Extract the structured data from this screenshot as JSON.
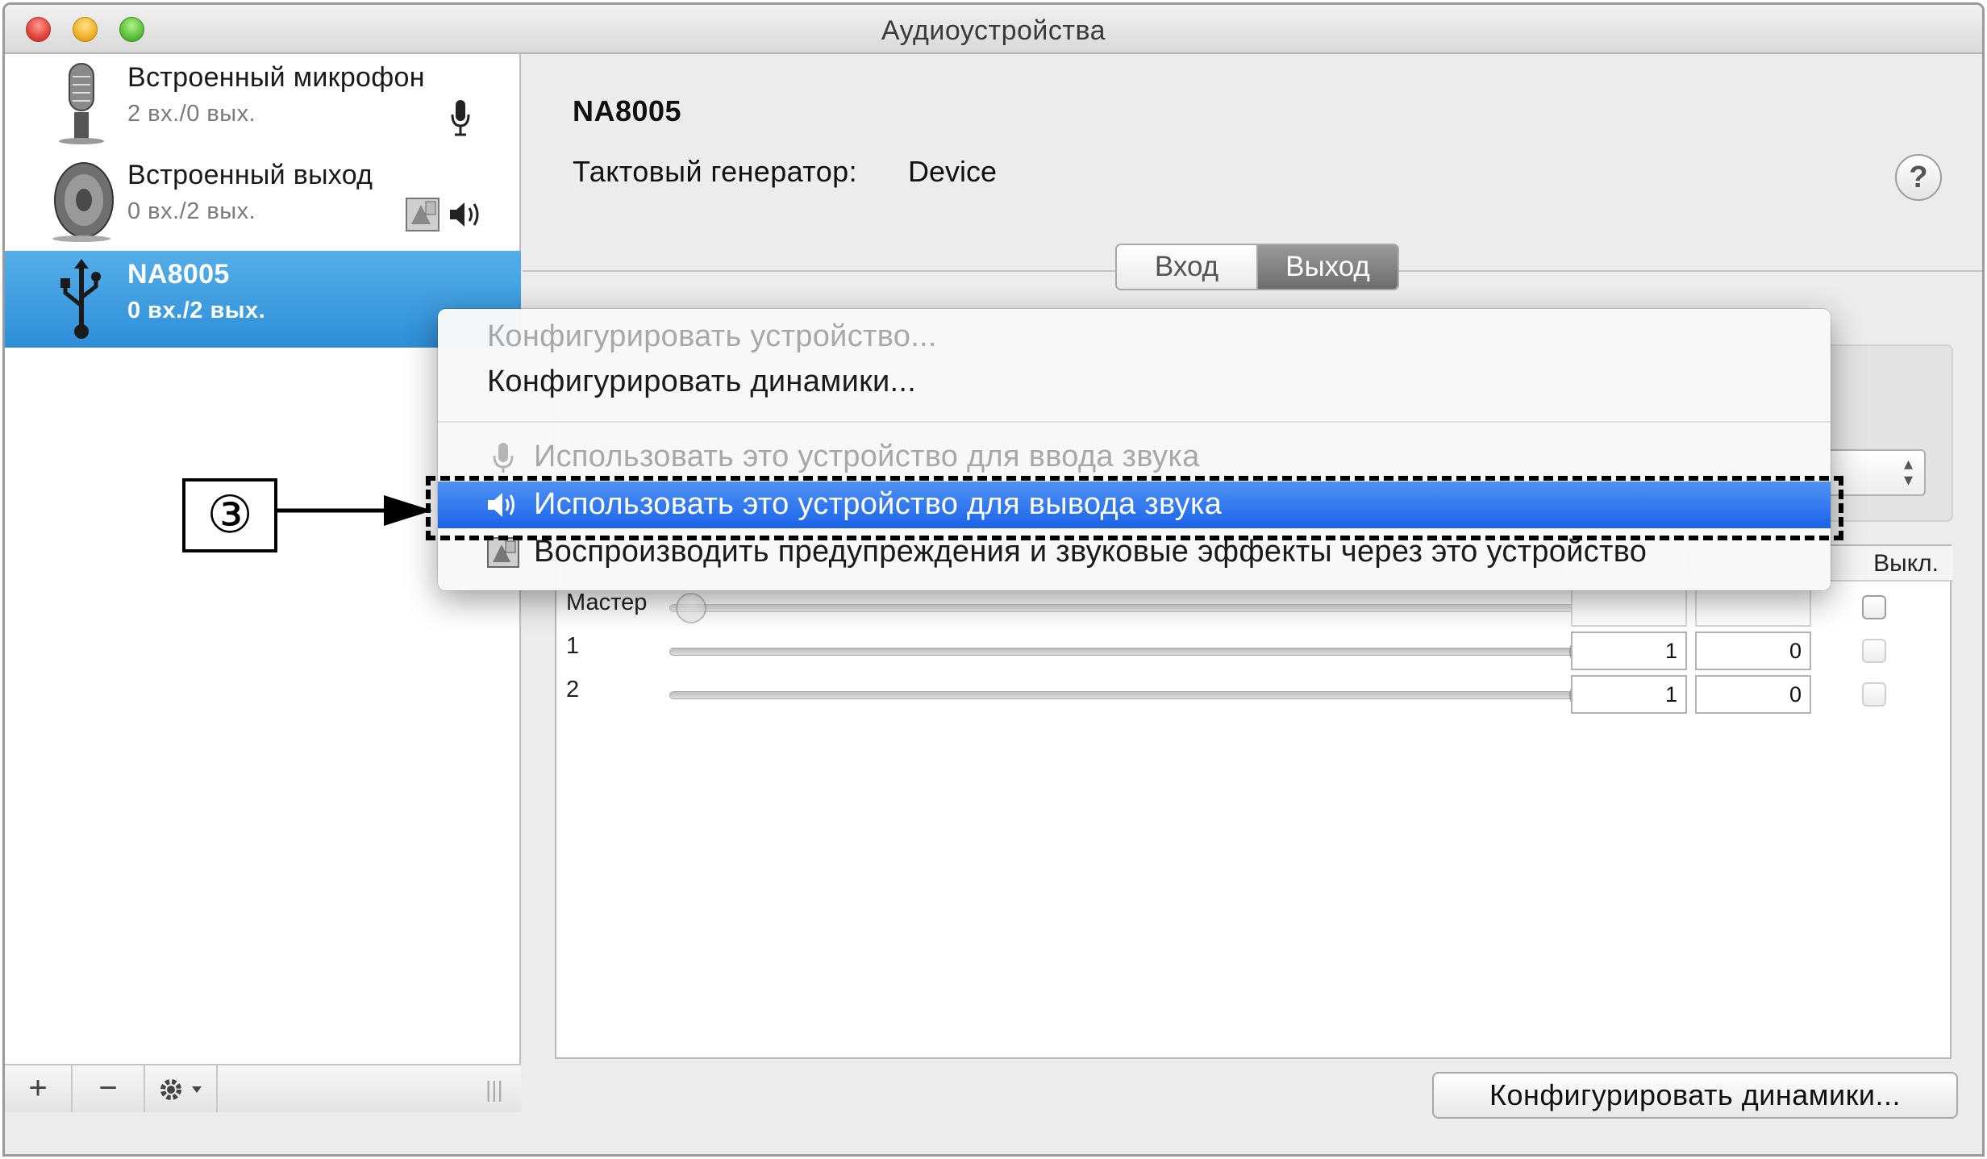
{
  "window": {
    "title": "Аудиоустройства"
  },
  "sidebar": {
    "devices": [
      {
        "name": "Встроенный микрофон",
        "channels": "2 вх./0 вых.",
        "icon": "microphone-icon",
        "badges": [
          "mic-badge-icon"
        ]
      },
      {
        "name": "Встроенный выход",
        "channels": "0 вх./2 вых.",
        "icon": "speaker-icon",
        "badges": [
          "alert-sound-badge-icon",
          "speaker-badge-icon"
        ]
      },
      {
        "name": "NA8005",
        "channels": "0 вх./2 вых.",
        "icon": "usb-icon",
        "selected": true
      }
    ],
    "toolbar": {
      "add": "+",
      "remove": "−",
      "gear": "gear-icon"
    }
  },
  "main": {
    "device_title": "NA8005",
    "clock_label": "Тактовый генератор:",
    "clock_value": "Device",
    "help": "?",
    "tabs": [
      {
        "label": "Вход",
        "active": false
      },
      {
        "label": "Выход",
        "active": true
      }
    ],
    "channels": {
      "mute_header": "Выкл.",
      "rows": [
        {
          "label": "Мастер",
          "value": null,
          "db": "",
          "num": "",
          "level": 0.0,
          "enabled": false
        },
        {
          "label": "1",
          "value": "1",
          "db": "0",
          "level": 1.0,
          "enabled": true
        },
        {
          "label": "2",
          "value": "1",
          "db": "0",
          "level": 1.0,
          "enabled": true
        }
      ]
    },
    "configure_speakers_button": "Конфигурировать динамики..."
  },
  "context_menu": {
    "items": [
      {
        "label": "Конфигурировать устройство...",
        "disabled": true
      },
      {
        "label": "Конфигурировать динамики...",
        "disabled": false
      },
      {
        "label": "Использовать это устройство для ввода звука",
        "disabled": true,
        "icon": "microphone-icon"
      },
      {
        "label": "Использовать это устройство для вывода звука",
        "highlighted": true,
        "icon": "speaker-icon"
      },
      {
        "label": "Воспроизводить предупреждения и звуковые эффекты через это устройство",
        "icon": "alert-sound-icon"
      }
    ]
  },
  "annotation": {
    "step": "③"
  },
  "colors": {
    "selection": "#2d8ed8",
    "menu_highlight": "#1b63e8"
  }
}
